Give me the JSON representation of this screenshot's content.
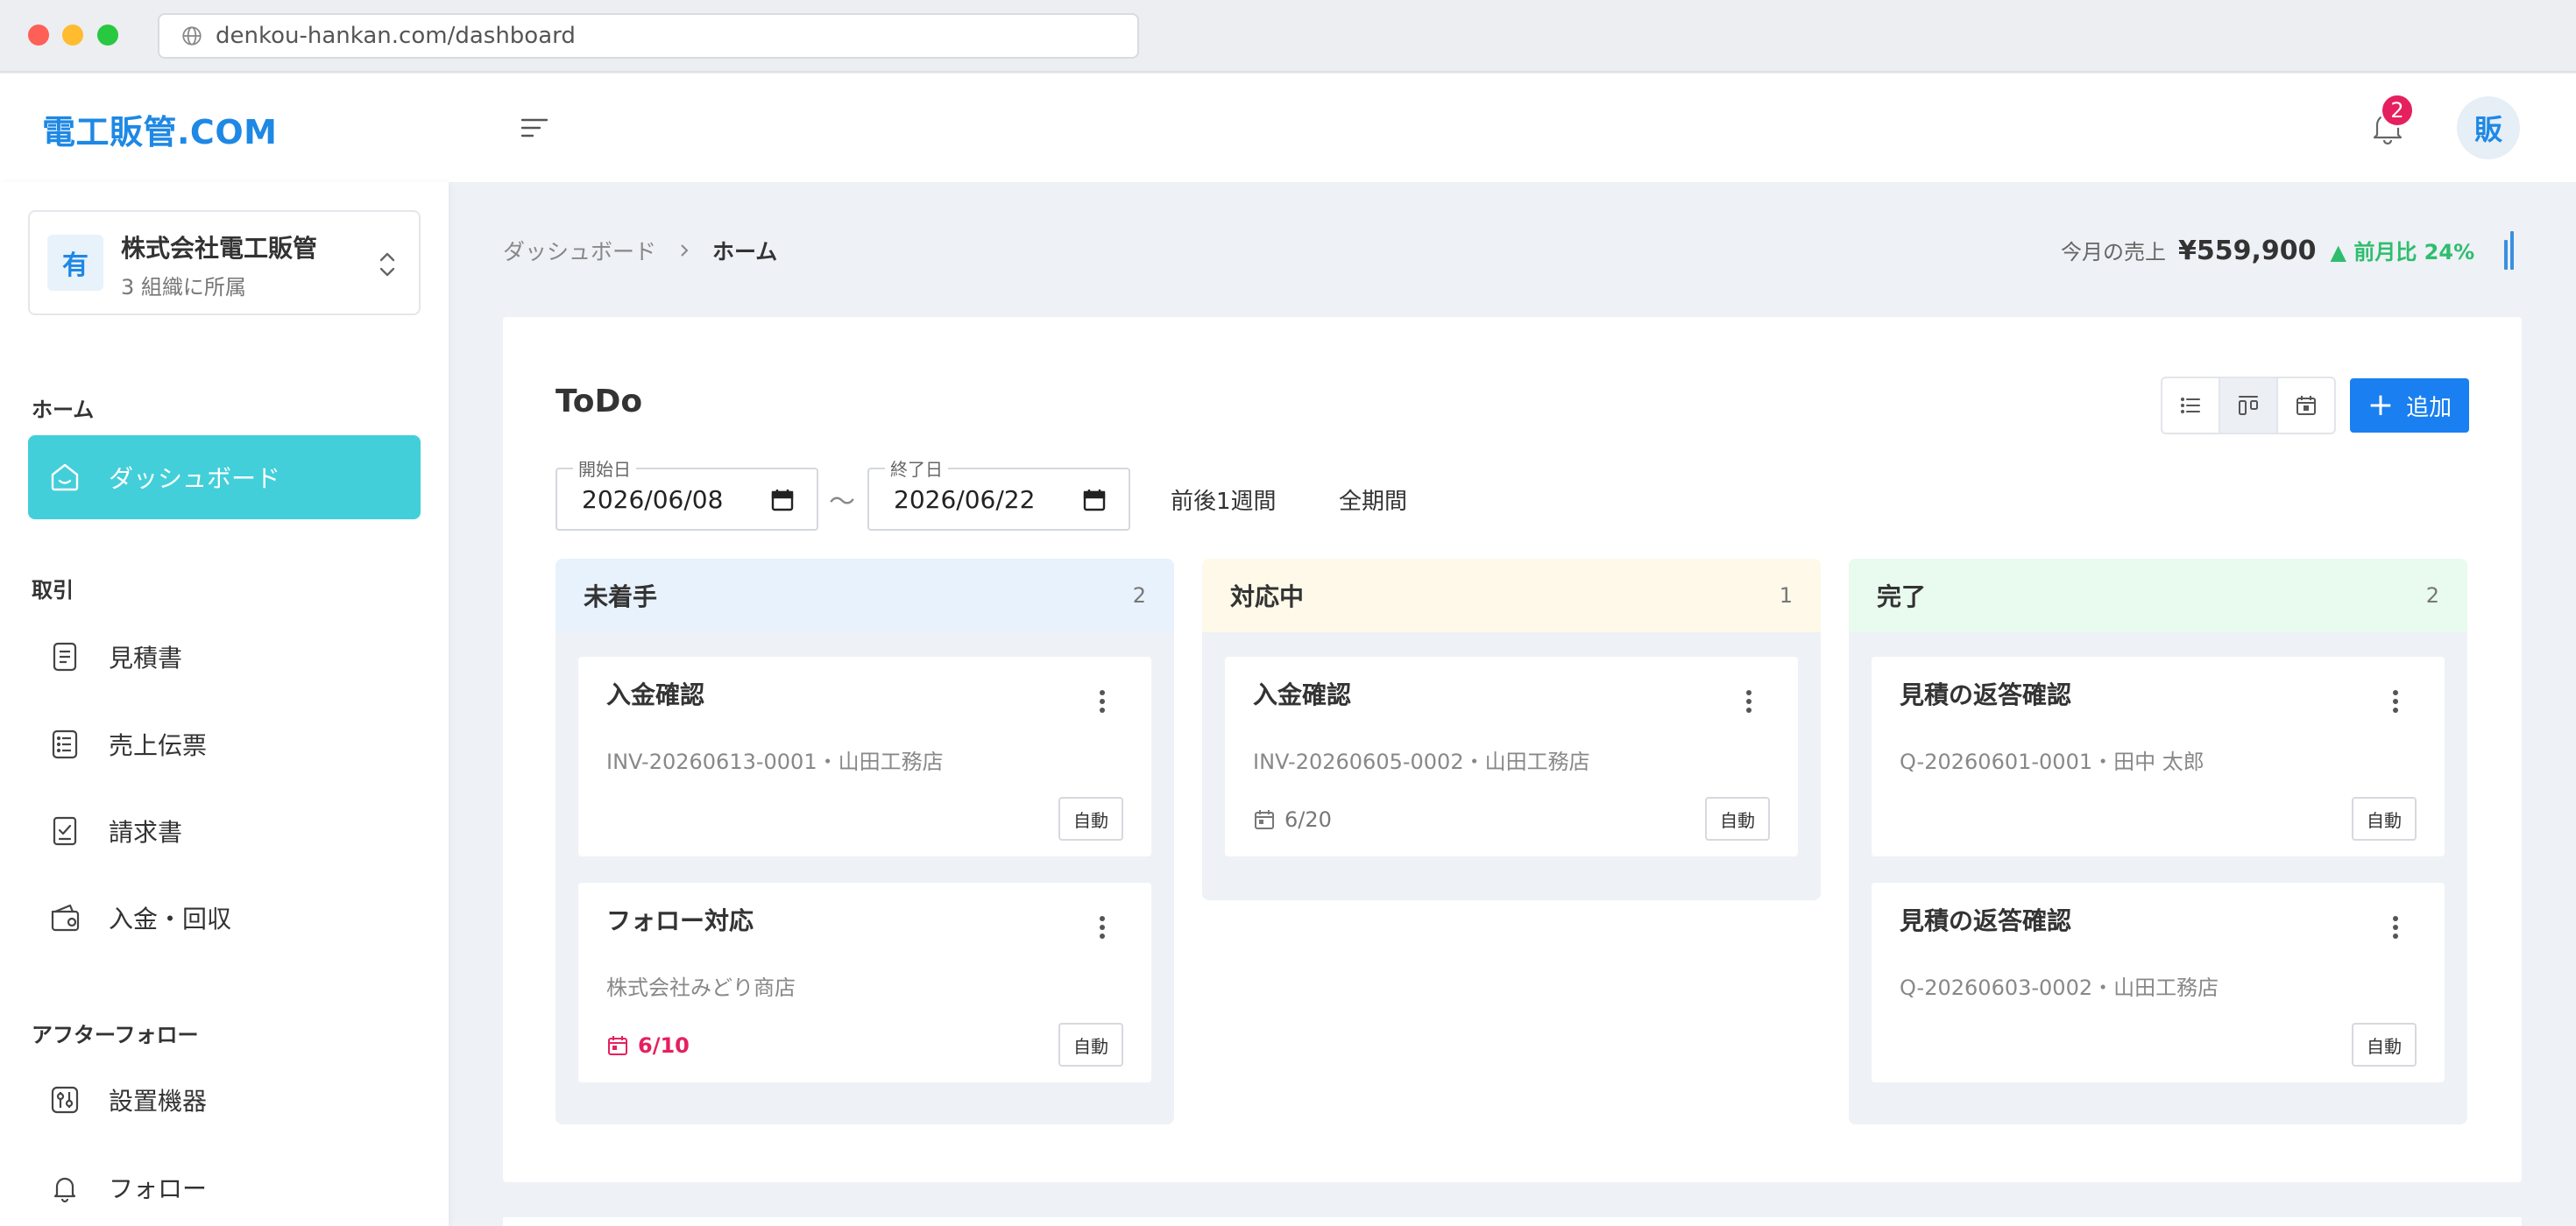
{
  "browser": {
    "url": "denkou-hankan.com/dashboard"
  },
  "header": {
    "logo": "電工販管.COM",
    "notification_count": "2",
    "avatar_initial": "販"
  },
  "sidebar": {
    "org": {
      "icon_letter": "有",
      "name": "株式会社電工販管",
      "sub": "3 組織に所属"
    },
    "sections": [
      {
        "title": "ホーム",
        "items": [
          {
            "label": "ダッシュボード",
            "icon": "home-icon",
            "active": true
          }
        ]
      },
      {
        "title": "取引",
        "items": [
          {
            "label": "見積書",
            "icon": "document-icon"
          },
          {
            "label": "売上伝票",
            "icon": "list-icon"
          },
          {
            "label": "請求書",
            "icon": "invoice-check-icon"
          },
          {
            "label": "入金・回収",
            "icon": "wallet-icon"
          }
        ]
      },
      {
        "title": "アフターフォロー",
        "items": [
          {
            "label": "設置機器",
            "icon": "device-settings-icon"
          },
          {
            "label": "フォロー",
            "icon": "bell-icon"
          }
        ]
      }
    ]
  },
  "breadcrumb": {
    "parent": "ダッシュボード",
    "current": "ホーム"
  },
  "sales_summary": {
    "label": "今月の売上",
    "amount": "¥559,900",
    "change": "▲ 前月比 24%"
  },
  "todo": {
    "title": "ToDo",
    "add_label": "追加",
    "view_modes": [
      "list",
      "kanban",
      "calendar"
    ],
    "active_view": "kanban",
    "start_date": {
      "label": "開始日",
      "value": "2026/06/08"
    },
    "range_separator": "〜",
    "end_date": {
      "label": "終了日",
      "value": "2026/06/22"
    },
    "quick_ranges": [
      "前後1週間",
      "全期間"
    ],
    "columns": [
      {
        "title": "未着手",
        "count": "2",
        "color": "#e8f2fc",
        "tasks": [
          {
            "title": "入金確認",
            "sub": "INV-20260613-0001・山田工務店",
            "date": "",
            "overdue": false,
            "tag": "自動"
          },
          {
            "title": "フォロー対応",
            "sub": "株式会社みどり商店",
            "date": "6/10",
            "overdue": true,
            "tag": "自動"
          }
        ]
      },
      {
        "title": "対応中",
        "count": "1",
        "color": "#fef9e9",
        "tasks": [
          {
            "title": "入金確認",
            "sub": "INV-20260605-0002・山田工務店",
            "date": "6/20",
            "overdue": false,
            "tag": "自動"
          }
        ]
      },
      {
        "title": "完了",
        "count": "2",
        "color": "#e9faee",
        "tasks": [
          {
            "title": "見積の返答確認",
            "sub": "Q-20260601-0001・田中 太郎",
            "date": "",
            "overdue": false,
            "tag": "自動"
          },
          {
            "title": "見積の返答確認",
            "sub": "Q-20260603-0002・山田工務店",
            "date": "",
            "overdue": false,
            "tag": "自動"
          }
        ]
      }
    ]
  },
  "colors": {
    "accent": "#1a7ff0",
    "active_nav": "#42cfd9",
    "badge": "#e5205e",
    "positive": "#2ebd6e"
  }
}
